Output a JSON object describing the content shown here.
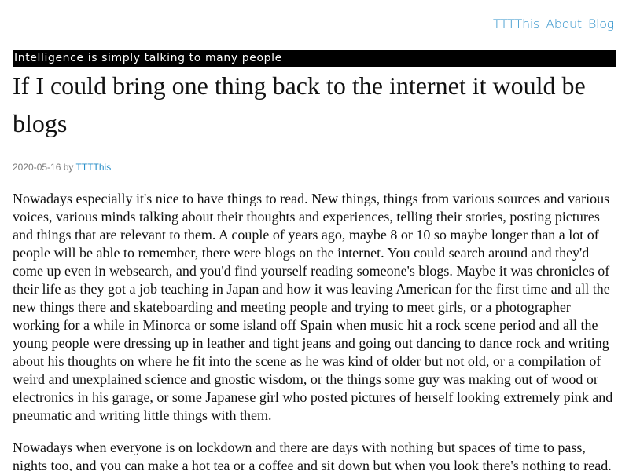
{
  "nav": {
    "items": [
      {
        "label": "TTTThis"
      },
      {
        "label": "About"
      },
      {
        "label": "Blog"
      }
    ]
  },
  "tagline": "Intelligence is simply talking to many people",
  "post": {
    "title": "If I could bring one thing back to the internet it would be blogs",
    "date": "2020-05-16",
    "by": "by",
    "author": "TTTThis",
    "paragraphs": [
      "Nowadays especially it's nice to have things to read. New things, things from various sources and various voices, various minds talking about their thoughts and experiences, telling their stories, posting pictures and things that are relevant to them. A couple of years ago, maybe 8 or 10 so maybe longer than a lot of people will be able to remember, there were blogs on the internet. You could search around and they'd come up even in websearch, and you'd find yourself reading someone's blogs. Maybe it was chronicles of their life as they got a job teaching in Japan and how it was leaving American for the first time and all the new things there and skateboarding and meeting people and trying to meet girls, or a photographer working for a while in Minorca or some island off Spain when music hit a rock scene period and all the young people were dressing up in leather and tight jeans and going out dancing to dance rock and writing about his thoughts on where he fit into the scene as he was kind of older but not old, or a compilation of weird and unexplained science and gnostic wisdom, or the things some guy was making out of wood or electronics in his garage, or some Japanese girl who posted pictures of herself looking extremely pink and pneumatic and writing little things with them.",
      "Nowadays when everyone is on lockdown and there are days with nothing but spaces of time to pass, nights too, and you can make a hot tea or a coffee and sit down but when you look there's nothing to read."
    ]
  },
  "colors": {
    "link": "#2a8fc9",
    "tagline_bg": "#000000",
    "tagline_fg": "#ffffff",
    "meta": "#7a7a7a"
  }
}
